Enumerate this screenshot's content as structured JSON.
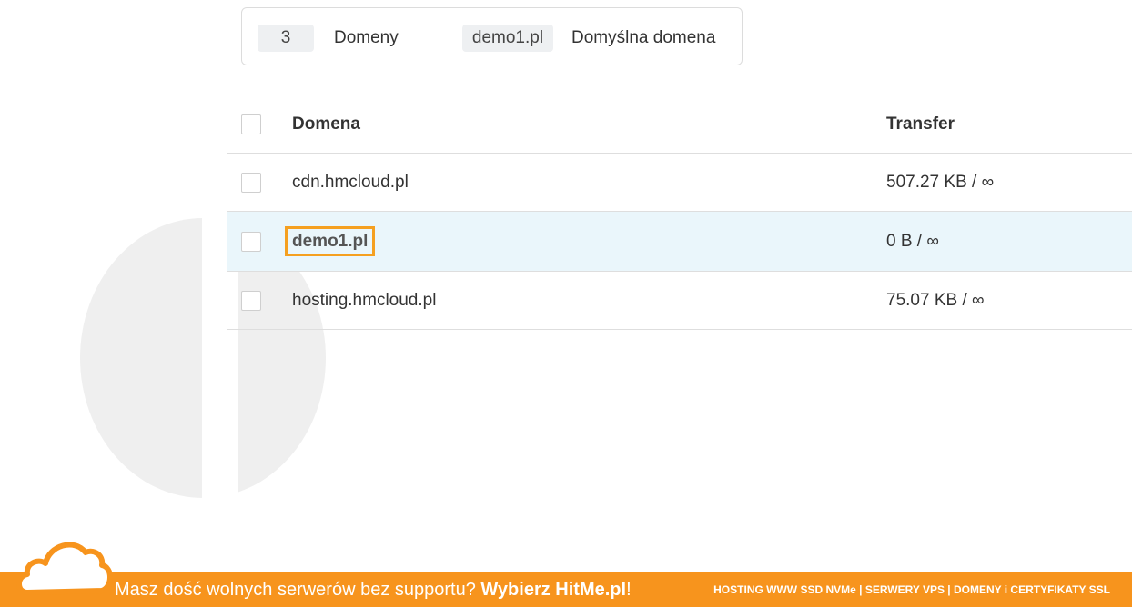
{
  "summary": {
    "domain_count": "3",
    "domain_count_label": "Domeny",
    "default_domain": "demo1.pl",
    "default_domain_label": "Domyślna domena"
  },
  "table": {
    "headers": {
      "domain": "Domena",
      "transfer": "Transfer"
    },
    "rows": [
      {
        "domain": "cdn.hmcloud.pl",
        "transfer": "507.27 KB / ∞"
      },
      {
        "domain": "demo1.pl",
        "transfer": "0 B / ∞"
      },
      {
        "domain": "hosting.hmcloud.pl",
        "transfer": "75.07 KB / ∞"
      }
    ]
  },
  "banner": {
    "text_prefix": "Masz dość wolnych serwerów bez supportu? ",
    "text_bold": "Wybierz HitMe.pl",
    "text_suffix": "!",
    "services": "HOSTING WWW SSD NVMe | SERWERY VPS | DOMENY i CERTYFIKATY SSL"
  },
  "colors": {
    "accent": "#f7941d",
    "highlight_row": "#eaf6fb",
    "selection_outline": "#f5a020"
  }
}
